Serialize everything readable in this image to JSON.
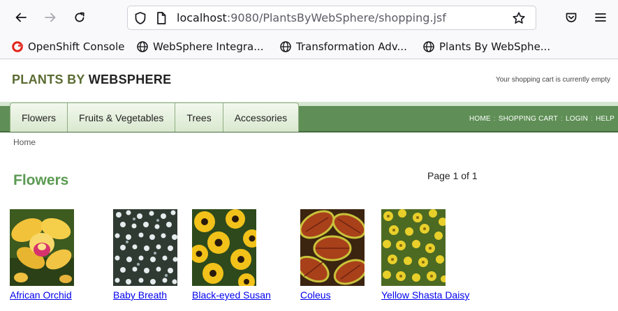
{
  "browser": {
    "url_host": "localhost",
    "url_path": ":9080/PlantsByWebSphere/shopping.jsf",
    "bookmarks": [
      {
        "label": "OpenShift Console",
        "icon": "openshift-icon"
      },
      {
        "label": "WebSphere Integra...",
        "icon": "globe-icon"
      },
      {
        "label": "Transformation Adv...",
        "icon": "globe-icon"
      },
      {
        "label": "Plants By WebSphe...",
        "icon": "globe-icon"
      }
    ]
  },
  "site": {
    "logo_part1": "PLANTS BY",
    "logo_part2": "WEBSPHERE",
    "cart_status": "Your shopping cart is currently empty",
    "tabs": [
      "Flowers",
      "Fruits & Vegetables",
      "Trees",
      "Accessories"
    ],
    "top_links": [
      "HOME",
      "SHOPPING CART",
      "LOGIN",
      "HELP"
    ],
    "breadcrumb": "Home",
    "heading": "Flowers",
    "page_indicator": "Page 1 of 1",
    "colors": {
      "brand_green": "#5f8f56",
      "heading_green": "#5b9a52",
      "link_blue": "#0000ee"
    }
  },
  "products": [
    {
      "name": "African Orchid"
    },
    {
      "name": "Baby Breath"
    },
    {
      "name": "Black-eyed Susan"
    },
    {
      "name": "Coleus"
    },
    {
      "name": "Yellow Shasta Daisy"
    }
  ]
}
